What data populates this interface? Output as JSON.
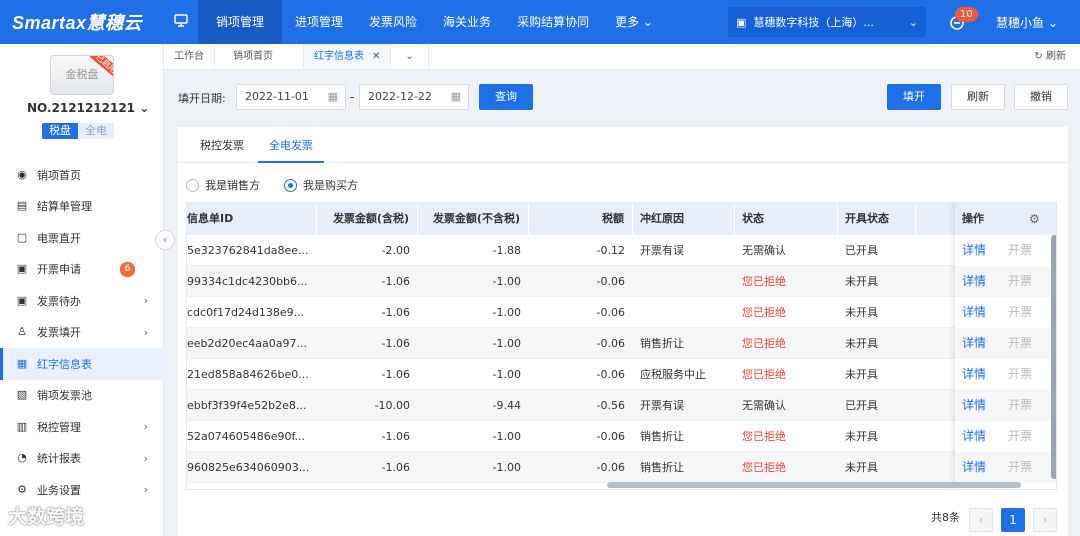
{
  "topbar": {
    "logo": "Smartax慧穗云",
    "nav": [
      "销项管理",
      "进项管理",
      "发票风险",
      "海关业务",
      "采购结算协同",
      "更多"
    ],
    "company": "慧穗数字科技（上海）...",
    "notify_count": "10",
    "user": "慧穗小鱼"
  },
  "sidebar": {
    "disk_label": "金税盘",
    "disk_ribbon": "已启用",
    "device_no": "NO.2121212121",
    "toggle": [
      "税盘",
      "全电"
    ],
    "items": [
      {
        "label": "销项首页",
        "icon": "home-icon"
      },
      {
        "label": "结算单管理",
        "icon": "settlement-icon"
      },
      {
        "label": "电票直开",
        "icon": "e-invoice-icon"
      },
      {
        "label": "开票申请",
        "icon": "apply-icon",
        "count": "6"
      },
      {
        "label": "发票待办",
        "icon": "todo-icon",
        "arrow": true
      },
      {
        "label": "发票填开",
        "icon": "fill-icon",
        "arrow": true
      },
      {
        "label": "红字信息表",
        "icon": "red-form-icon",
        "active": true
      },
      {
        "label": "销项发票池",
        "icon": "pool-icon"
      },
      {
        "label": "税控管理",
        "icon": "tax-control-icon",
        "arrow": true
      },
      {
        "label": "统计报表",
        "icon": "report-icon",
        "arrow": true
      },
      {
        "label": "业务设置",
        "icon": "settings-icon",
        "arrow": true
      }
    ]
  },
  "watermark": "大数跨境",
  "tabs": [
    "工作台",
    "销项首页",
    "红字信息表"
  ],
  "refresh_tab": "刷新",
  "filter": {
    "label": "填开日期:",
    "start": "2022-11-01",
    "end": "2022-12-22",
    "query": "查询",
    "btn_fill": "填开",
    "btn_refresh": "刷新",
    "btn_cancel": "撤销"
  },
  "panel_tabs": [
    "税控发票",
    "全电发票"
  ],
  "radios": [
    "我是销售方",
    "我是购买方"
  ],
  "columns": [
    "信息单ID",
    "发票金额(含税)",
    "发票金额(不含税)",
    "税额",
    "冲红原因",
    "状态",
    "开具状态",
    "操作"
  ],
  "rows": [
    {
      "id": "5e323762841da8ee...",
      "incl": "-2.00",
      "excl": "-1.88",
      "tax": "-0.12",
      "reason": "开票有误",
      "status": "无需确认",
      "issue": "已开具"
    },
    {
      "id": "99334c1dc4230bb6...",
      "incl": "-1.06",
      "excl": "-1.00",
      "tax": "-0.06",
      "reason": "",
      "status": "您已拒绝",
      "issue": "未开具"
    },
    {
      "id": "cdc0f17d24d138e9...",
      "incl": "-1.06",
      "excl": "-1.00",
      "tax": "-0.06",
      "reason": "",
      "status": "您已拒绝",
      "issue": "未开具"
    },
    {
      "id": "eeb2d20ec4aa0a97...",
      "incl": "-1.06",
      "excl": "-1.00",
      "tax": "-0.06",
      "reason": "销售折让",
      "status": "您已拒绝",
      "issue": "未开具"
    },
    {
      "id": "21ed858a84626be0...",
      "incl": "-1.06",
      "excl": "-1.00",
      "tax": "-0.06",
      "reason": "应税服务中止",
      "status": "您已拒绝",
      "issue": "未开具"
    },
    {
      "id": "ebbf3f39f4e52b2e8...",
      "incl": "-10.00",
      "excl": "-9.44",
      "tax": "-0.56",
      "reason": "开票有误",
      "status": "无需确认",
      "issue": "已开具"
    },
    {
      "id": "52a074605486e90f...",
      "incl": "-1.06",
      "excl": "-1.00",
      "tax": "-0.06",
      "reason": "销售折让",
      "status": "您已拒绝",
      "issue": "未开具"
    },
    {
      "id": "960825e634060903...",
      "incl": "-1.06",
      "excl": "-1.00",
      "tax": "-0.06",
      "reason": "销售折让",
      "status": "您已拒绝",
      "issue": "未开具"
    }
  ],
  "row_actions": [
    "详情",
    "开票"
  ],
  "pager": {
    "total": "共8条",
    "current": "1",
    "prev": "‹",
    "next": "›"
  },
  "colors": {
    "primary": "#1f6fe6",
    "rejected": "#e8453c"
  }
}
